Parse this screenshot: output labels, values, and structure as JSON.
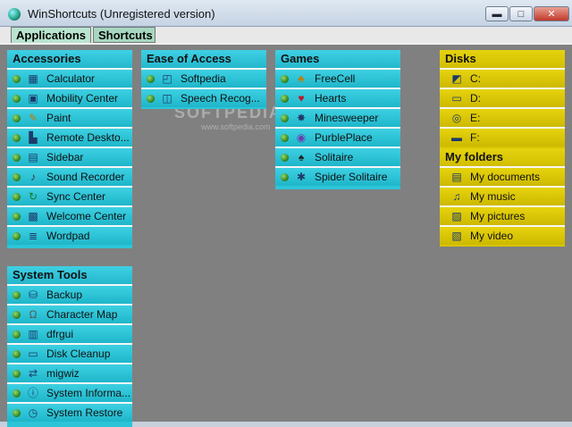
{
  "window": {
    "title": "WinShortcuts (Unregistered version)"
  },
  "tabs": [
    {
      "label": "Applications"
    },
    {
      "label": "Shortcuts"
    }
  ],
  "watermark": {
    "text": "SOFTPEDIA",
    "sub": "www.softpedia.com"
  },
  "panels": {
    "accessories": {
      "title": "Accessories",
      "items": [
        {
          "label": "Calculator",
          "icon": "calculator-icon"
        },
        {
          "label": "Mobility Center",
          "icon": "mobility-center-icon"
        },
        {
          "label": "Paint",
          "icon": "paint-icon"
        },
        {
          "label": "Remote Deskto...",
          "icon": "remote-desktop-icon"
        },
        {
          "label": "Sidebar",
          "icon": "sidebar-icon"
        },
        {
          "label": "Sound Recorder",
          "icon": "microphone-icon"
        },
        {
          "label": "Sync Center",
          "icon": "sync-icon"
        },
        {
          "label": "Welcome Center",
          "icon": "welcome-center-icon"
        },
        {
          "label": "Wordpad",
          "icon": "wordpad-icon"
        }
      ]
    },
    "ease_of_access": {
      "title": "Ease of Access",
      "items": [
        {
          "label": "Softpedia",
          "icon": "softpedia-icon"
        },
        {
          "label": "Speech Recog...",
          "icon": "speech-recognition-icon"
        }
      ]
    },
    "games": {
      "title": "Games",
      "items": [
        {
          "label": "FreeCell",
          "icon": "freecell-icon"
        },
        {
          "label": "Hearts",
          "icon": "hearts-icon"
        },
        {
          "label": "Minesweeper",
          "icon": "minesweeper-icon"
        },
        {
          "label": "PurblePlace",
          "icon": "purbleplace-icon"
        },
        {
          "label": "Solitaire",
          "icon": "solitaire-icon"
        },
        {
          "label": "Spider Solitaire",
          "icon": "spider-solitaire-icon"
        }
      ]
    },
    "disks": {
      "title": "Disks",
      "items": [
        {
          "label": "C:",
          "icon": "drive-c-icon"
        },
        {
          "label": "D:",
          "icon": "drive-d-icon"
        },
        {
          "label": "E:",
          "icon": "cd-drive-icon"
        },
        {
          "label": "F:",
          "icon": "removable-drive-icon"
        }
      ]
    },
    "my_folders": {
      "title": "My folders",
      "items": [
        {
          "label": "My documents",
          "icon": "documents-folder-icon"
        },
        {
          "label": "My music",
          "icon": "music-folder-icon"
        },
        {
          "label": "My pictures",
          "icon": "pictures-folder-icon"
        },
        {
          "label": "My video",
          "icon": "video-folder-icon"
        }
      ]
    },
    "system_tools": {
      "title": "System Tools",
      "items": [
        {
          "label": "Backup",
          "icon": "backup-icon"
        },
        {
          "label": "Character Map",
          "icon": "character-map-icon"
        },
        {
          "label": "dfrgui",
          "icon": "defragmenter-icon"
        },
        {
          "label": "Disk Cleanup",
          "icon": "disk-cleanup-icon"
        },
        {
          "label": "migwiz",
          "icon": "migration-wizard-icon"
        },
        {
          "label": "System Informa...",
          "icon": "system-information-icon"
        },
        {
          "label": "System Restore",
          "icon": "system-restore-icon"
        }
      ]
    }
  }
}
